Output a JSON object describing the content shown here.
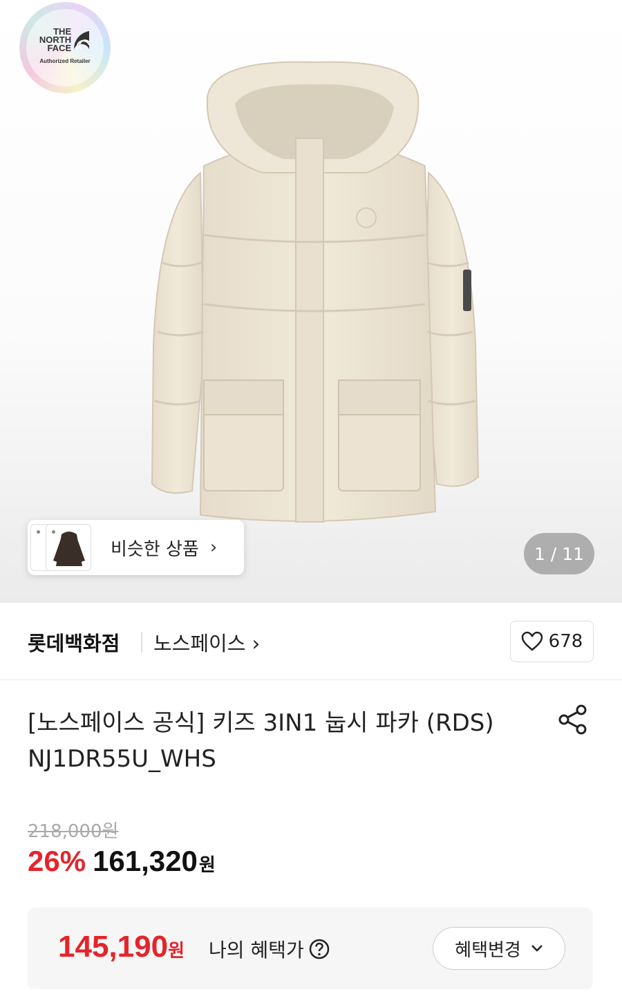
{
  "badge": {
    "logo_text": "THE\nNORTH\nFACE",
    "subtitle": "Authorized Retailer"
  },
  "similar_products": {
    "label": "비슷한 상품",
    "arrow": "›"
  },
  "image_counter": "1 / 11",
  "store": {
    "name": "롯데백화점",
    "brand": "노스페이스 ›",
    "like_count": "678"
  },
  "product": {
    "title": "[노스페이스 공식] 키즈 3IN1 눕시 파카 (RDS) NJ1DR55U_WHS"
  },
  "pricing": {
    "original": "218,000원",
    "discount": "26%",
    "sale": "161,320",
    "currency": "원",
    "benefit_price": "145,190",
    "benefit_label": "나의 혜택가",
    "change_button": "혜택변경"
  },
  "colors": {
    "accent_red": "#e5242b",
    "jacket": "#efe7d8"
  }
}
